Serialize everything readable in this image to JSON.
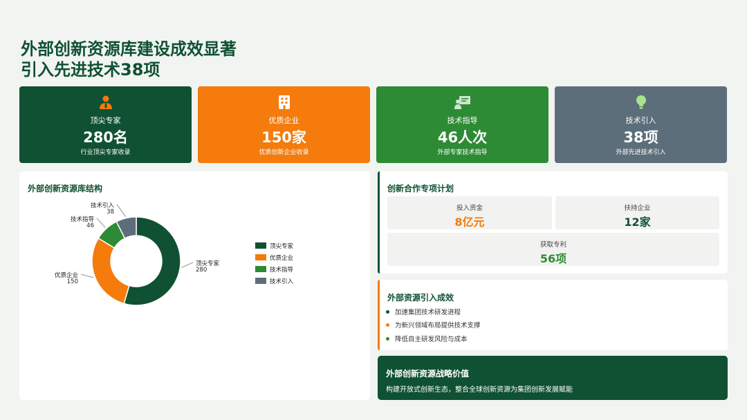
{
  "title": {
    "line1": "外部创新资源库建设成效显著",
    "line2": "引入先进技术38项"
  },
  "cards": [
    {
      "label": "顶尖专家",
      "value": "280名",
      "sub": "行业顶尖专家收录",
      "color": "#0f5132",
      "icon": "expert-icon"
    },
    {
      "label": "优质企业",
      "value": "150家",
      "sub": "优质创新企业收录",
      "color": "#f47b0c",
      "icon": "building-icon"
    },
    {
      "label": "技术指导",
      "value": "46人次",
      "sub": "外部专家技术指导",
      "color": "#2e8b35",
      "icon": "presentation-icon"
    },
    {
      "label": "技术引入",
      "value": "38项",
      "sub": "外部先进技术引入",
      "color": "#5c6e7a",
      "icon": "lightbulb-icon"
    }
  ],
  "chart_panel": {
    "title": "外部创新资源库结构"
  },
  "chart_data": {
    "type": "pie",
    "donut": true,
    "categories": [
      "顶尖专家",
      "优质企业",
      "技术指导",
      "技术引入"
    ],
    "values": [
      280,
      150,
      46,
      38
    ],
    "colors": [
      "#0f5132",
      "#f47b0c",
      "#2e8b35",
      "#5c6e7a"
    ],
    "legend_position": "right"
  },
  "plan": {
    "title": "创新合作专项计划",
    "stats": [
      {
        "label": "投入资金",
        "value": "8亿元",
        "color": "#f47b0c"
      },
      {
        "label": "扶持企业",
        "value": "12家",
        "color": "#0f5132"
      },
      {
        "label": "获取专利",
        "value": "56项",
        "color": "#2e8b35"
      }
    ]
  },
  "results": {
    "title": "外部资源引入成效",
    "items": [
      {
        "text": "加速集团技术研发进程",
        "color": "#0f5132"
      },
      {
        "text": "为新兴领域布局提供技术支撑",
        "color": "#f47b0c"
      },
      {
        "text": "降低自主研发风险与成本",
        "color": "#2e8b35"
      }
    ]
  },
  "strategy": {
    "title": "外部创新资源战略价值",
    "text": "构建开放式创新生态，整合全球创新资源为集团创新发展赋能"
  }
}
